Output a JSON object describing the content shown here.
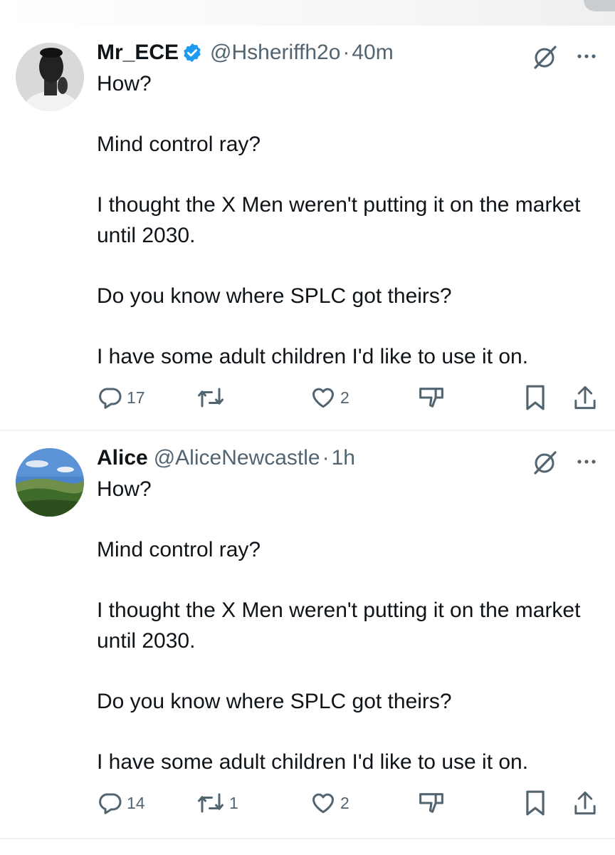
{
  "tweets": [
    {
      "author_name": "Mr_ECE",
      "verified": true,
      "handle": "@Hsheriffh2o",
      "separator": "·",
      "time": "40m",
      "paragraphs": [
        "How?",
        "Mind control ray?",
        "I thought the X Men weren't putting it on the market until 2030.",
        "Do you know where SPLC got theirs?",
        "I have some adult children I'd like to use it on."
      ],
      "replies": "17",
      "retweets": "",
      "likes": "2"
    },
    {
      "author_name": "Alice",
      "verified": false,
      "handle": "@AliceNewcastle",
      "separator": "·",
      "time": "1h",
      "paragraphs": [
        "How?",
        "Mind control ray?",
        "I thought the X Men weren't putting it on the market until 2030.",
        "Do you know where SPLC got theirs?",
        "I have some adult children I'd like to use it on."
      ],
      "replies": "14",
      "retweets": "1",
      "likes": "2"
    }
  ],
  "colors": {
    "text_primary": "#0f1419",
    "text_secondary": "#536471",
    "verified_blue": "#1d9bf0",
    "divider": "#eff3f4"
  },
  "icons": [
    "reply-icon",
    "retweet-icon",
    "like-icon",
    "downvote-icon",
    "bookmark-icon",
    "share-icon",
    "grok-icon",
    "more-icon",
    "verified-badge-icon"
  ]
}
